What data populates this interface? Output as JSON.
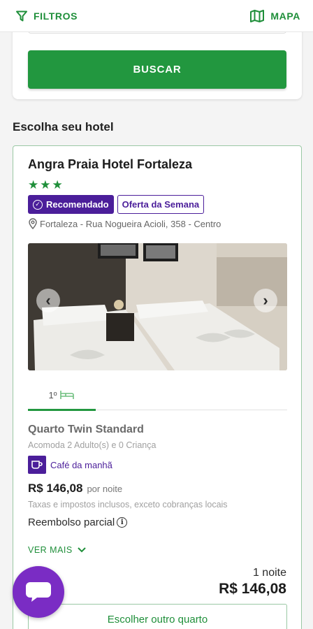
{
  "topbar": {
    "filters_label": "FILTROS",
    "map_label": "MAPA",
    "filter_icon": "filter-icon",
    "map_icon": "map-icon"
  },
  "search": {
    "button_label": "BUSCAR"
  },
  "section": {
    "title": "Escolha seu hotel"
  },
  "hotel": {
    "name": "Angra Praia Hotel Fortaleza",
    "stars": "★★★",
    "star_count": 3,
    "badges": {
      "recommended": "Recomendado",
      "offer": "Oferta da Semana"
    },
    "address": "Fortaleza - Rua Nogueira Acioli, 358 - Centro",
    "room_tab": {
      "label": "1º",
      "icon": "bed-icon"
    },
    "room": {
      "name": "Quarto Twin Standard",
      "occupancy": "Acomoda 2 Adulto(s) e 0 Criança",
      "breakfast": "Café da manhã",
      "price": "R$ 146,08",
      "per_night": "por noite",
      "taxes": "Taxas e impostos inclusos, exceto cobranças locais",
      "refund": "Reembolso parcial",
      "see_more": "VER MAIS"
    },
    "nights": "1 noite",
    "total": "R$ 146,08",
    "choose_button": "Escolher outro quarto"
  },
  "colors": {
    "brand_green": "#22973f",
    "badge_purple": "#4b1e9a",
    "chat_purple": "#7a2cc4"
  }
}
